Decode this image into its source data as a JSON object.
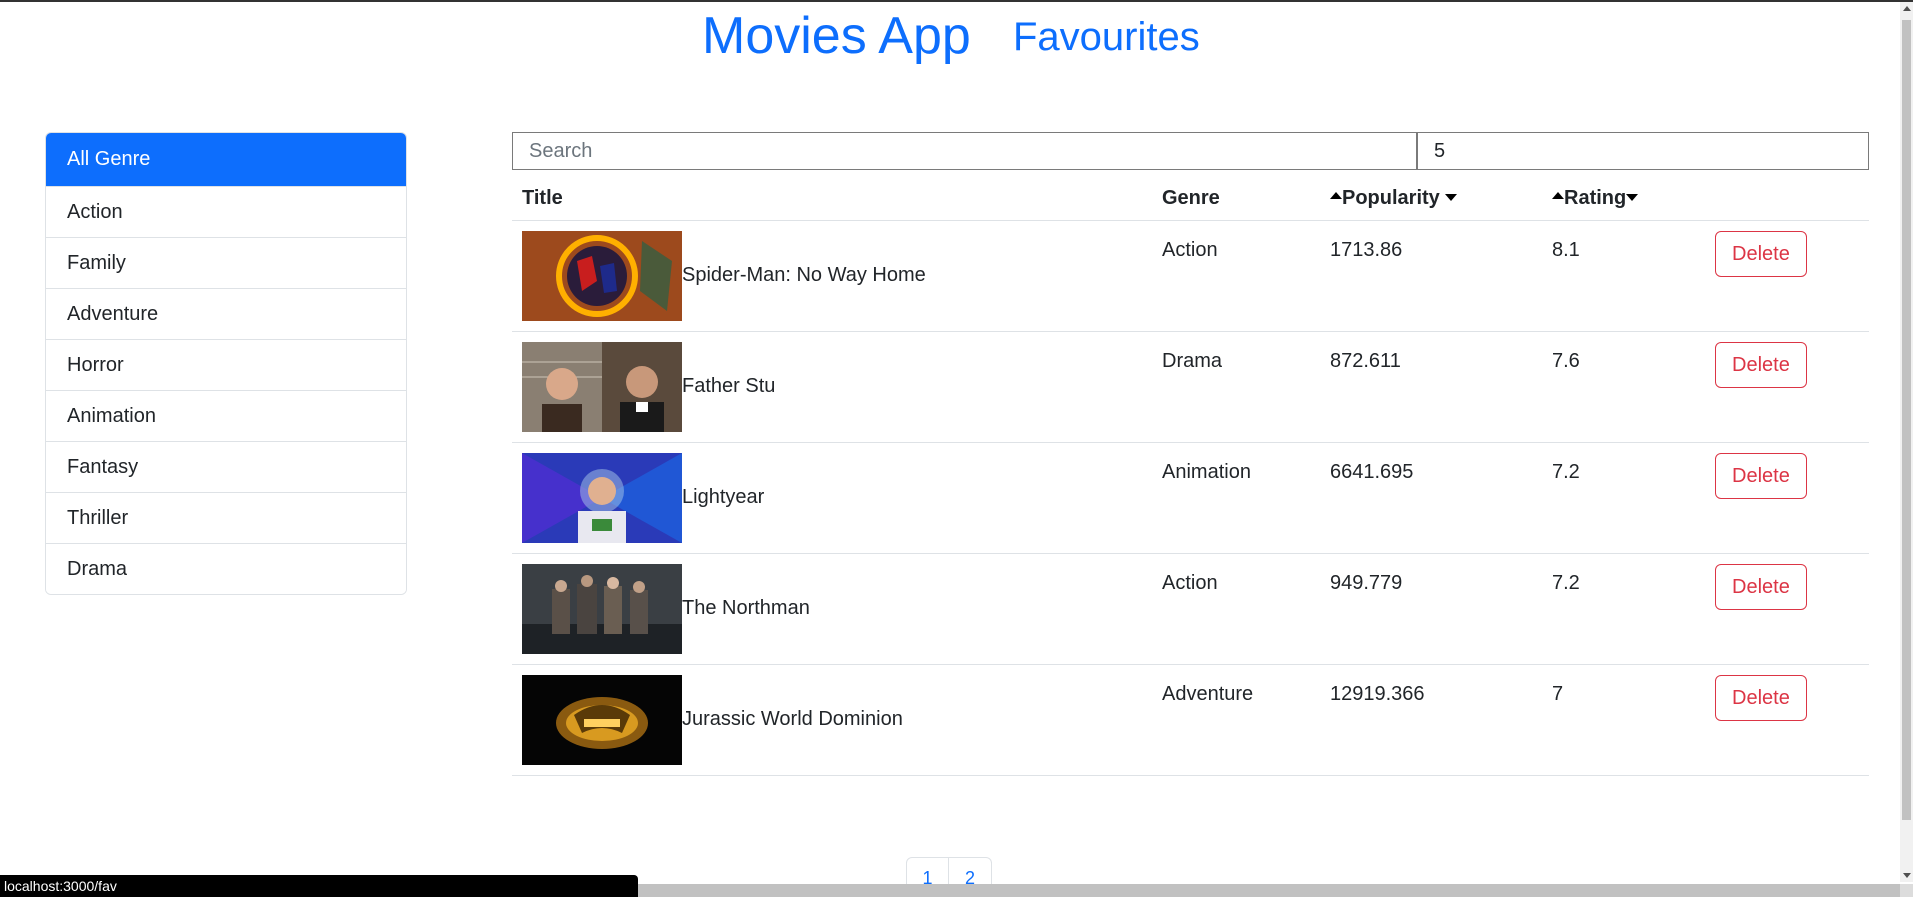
{
  "header": {
    "brand": "Movies App",
    "favourites_link": "Favourites"
  },
  "genres": [
    {
      "label": "All Genre",
      "active": true
    },
    {
      "label": "Action"
    },
    {
      "label": "Family"
    },
    {
      "label": "Adventure"
    },
    {
      "label": "Horror"
    },
    {
      "label": "Animation"
    },
    {
      "label": "Fantasy"
    },
    {
      "label": "Thriller"
    },
    {
      "label": "Drama"
    }
  ],
  "search": {
    "placeholder": "Search",
    "value": "",
    "count_value": "5"
  },
  "table": {
    "headers": {
      "title": "Title",
      "genre": "Genre",
      "popularity": "Popularity",
      "rating": "Rating"
    },
    "delete_label": "Delete",
    "rows": [
      {
        "title": "Spider-Man: No Way Home",
        "genre": "Action",
        "popularity": "1713.86",
        "rating": "8.1",
        "poster": "spiderman-poster"
      },
      {
        "title": "Father Stu",
        "genre": "Drama",
        "popularity": "872.611",
        "rating": "7.6",
        "poster": "father-stu-poster"
      },
      {
        "title": "Lightyear",
        "genre": "Animation",
        "popularity": "6641.695",
        "rating": "7.2",
        "poster": "lightyear-poster"
      },
      {
        "title": "The Northman",
        "genre": "Action",
        "popularity": "949.779",
        "rating": "7.2",
        "poster": "northman-poster"
      },
      {
        "title": "Jurassic World Dominion",
        "genre": "Adventure",
        "popularity": "12919.366",
        "rating": "7",
        "poster": "jurassic-poster"
      }
    ]
  },
  "pagination": {
    "pages": [
      "1",
      "2"
    ]
  },
  "status_bar": {
    "url": "localhost:3000/fav"
  },
  "colors": {
    "primary": "#0d6efd",
    "danger": "#dc3545"
  }
}
